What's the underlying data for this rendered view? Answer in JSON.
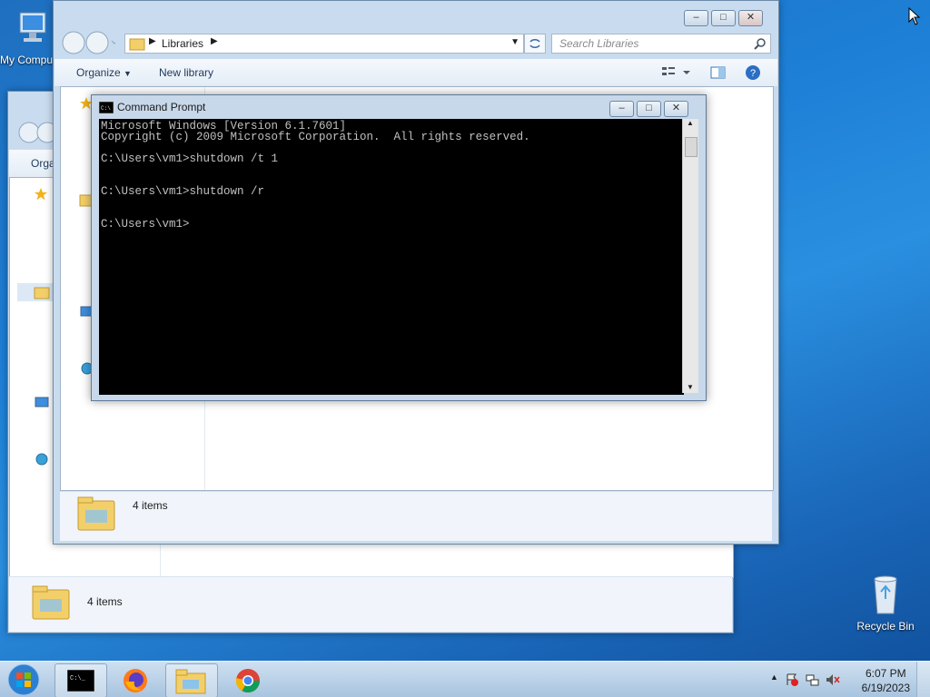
{
  "desktop": {
    "my_computer_label": "My Computer",
    "recycle_bin_label": "Recycle Bin"
  },
  "explorer_front": {
    "breadcrumb": "Libraries",
    "search_placeholder": "Search Libraries",
    "organize_label": "Organize",
    "new_library_label": "New library",
    "status_text": "4 items"
  },
  "explorer_back": {
    "organize_label": "Orga",
    "status_text": "4 items"
  },
  "cmd": {
    "title": "Command Prompt",
    "lines": [
      "Microsoft Windows [Version 6.1.7601]",
      "Copyright (c) 2009 Microsoft Corporation.  All rights reserved.",
      "",
      "C:\\Users\\vm1>shutdown /t 1",
      "",
      "",
      "C:\\Users\\vm1>shutdown /r",
      "",
      "",
      "C:\\Users\\vm1>"
    ]
  },
  "taskbar": {
    "clock_time": "6:07 PM",
    "clock_date": "6/19/2023",
    "items": [
      "start",
      "command-prompt",
      "firefox",
      "windows-explorer",
      "chrome"
    ]
  },
  "colors": {
    "desktop_blue": "#1d7fd6",
    "cmd_background": "#000000",
    "cmd_text": "#c0c0c0"
  }
}
